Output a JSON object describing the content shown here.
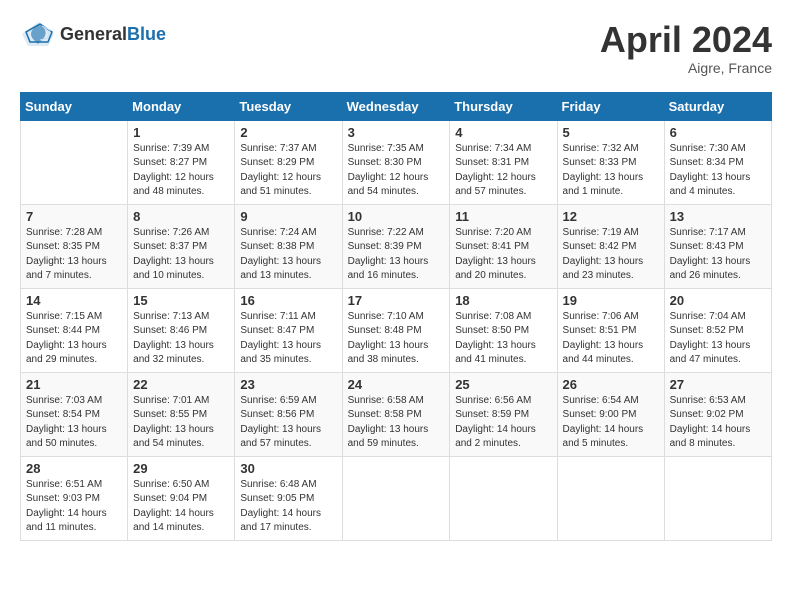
{
  "logo": {
    "general": "General",
    "blue": "Blue"
  },
  "title": "April 2024",
  "location": "Aigre, France",
  "calendar": {
    "headers": [
      "Sunday",
      "Monday",
      "Tuesday",
      "Wednesday",
      "Thursday",
      "Friday",
      "Saturday"
    ],
    "weeks": [
      [
        {
          "day": "",
          "info": ""
        },
        {
          "day": "1",
          "info": "Sunrise: 7:39 AM\nSunset: 8:27 PM\nDaylight: 12 hours\nand 48 minutes."
        },
        {
          "day": "2",
          "info": "Sunrise: 7:37 AM\nSunset: 8:29 PM\nDaylight: 12 hours\nand 51 minutes."
        },
        {
          "day": "3",
          "info": "Sunrise: 7:35 AM\nSunset: 8:30 PM\nDaylight: 12 hours\nand 54 minutes."
        },
        {
          "day": "4",
          "info": "Sunrise: 7:34 AM\nSunset: 8:31 PM\nDaylight: 12 hours\nand 57 minutes."
        },
        {
          "day": "5",
          "info": "Sunrise: 7:32 AM\nSunset: 8:33 PM\nDaylight: 13 hours\nand 1 minute."
        },
        {
          "day": "6",
          "info": "Sunrise: 7:30 AM\nSunset: 8:34 PM\nDaylight: 13 hours\nand 4 minutes."
        }
      ],
      [
        {
          "day": "7",
          "info": "Sunrise: 7:28 AM\nSunset: 8:35 PM\nDaylight: 13 hours\nand 7 minutes."
        },
        {
          "day": "8",
          "info": "Sunrise: 7:26 AM\nSunset: 8:37 PM\nDaylight: 13 hours\nand 10 minutes."
        },
        {
          "day": "9",
          "info": "Sunrise: 7:24 AM\nSunset: 8:38 PM\nDaylight: 13 hours\nand 13 minutes."
        },
        {
          "day": "10",
          "info": "Sunrise: 7:22 AM\nSunset: 8:39 PM\nDaylight: 13 hours\nand 16 minutes."
        },
        {
          "day": "11",
          "info": "Sunrise: 7:20 AM\nSunset: 8:41 PM\nDaylight: 13 hours\nand 20 minutes."
        },
        {
          "day": "12",
          "info": "Sunrise: 7:19 AM\nSunset: 8:42 PM\nDaylight: 13 hours\nand 23 minutes."
        },
        {
          "day": "13",
          "info": "Sunrise: 7:17 AM\nSunset: 8:43 PM\nDaylight: 13 hours\nand 26 minutes."
        }
      ],
      [
        {
          "day": "14",
          "info": "Sunrise: 7:15 AM\nSunset: 8:44 PM\nDaylight: 13 hours\nand 29 minutes."
        },
        {
          "day": "15",
          "info": "Sunrise: 7:13 AM\nSunset: 8:46 PM\nDaylight: 13 hours\nand 32 minutes."
        },
        {
          "day": "16",
          "info": "Sunrise: 7:11 AM\nSunset: 8:47 PM\nDaylight: 13 hours\nand 35 minutes."
        },
        {
          "day": "17",
          "info": "Sunrise: 7:10 AM\nSunset: 8:48 PM\nDaylight: 13 hours\nand 38 minutes."
        },
        {
          "day": "18",
          "info": "Sunrise: 7:08 AM\nSunset: 8:50 PM\nDaylight: 13 hours\nand 41 minutes."
        },
        {
          "day": "19",
          "info": "Sunrise: 7:06 AM\nSunset: 8:51 PM\nDaylight: 13 hours\nand 44 minutes."
        },
        {
          "day": "20",
          "info": "Sunrise: 7:04 AM\nSunset: 8:52 PM\nDaylight: 13 hours\nand 47 minutes."
        }
      ],
      [
        {
          "day": "21",
          "info": "Sunrise: 7:03 AM\nSunset: 8:54 PM\nDaylight: 13 hours\nand 50 minutes."
        },
        {
          "day": "22",
          "info": "Sunrise: 7:01 AM\nSunset: 8:55 PM\nDaylight: 13 hours\nand 54 minutes."
        },
        {
          "day": "23",
          "info": "Sunrise: 6:59 AM\nSunset: 8:56 PM\nDaylight: 13 hours\nand 57 minutes."
        },
        {
          "day": "24",
          "info": "Sunrise: 6:58 AM\nSunset: 8:58 PM\nDaylight: 13 hours\nand 59 minutes."
        },
        {
          "day": "25",
          "info": "Sunrise: 6:56 AM\nSunset: 8:59 PM\nDaylight: 14 hours\nand 2 minutes."
        },
        {
          "day": "26",
          "info": "Sunrise: 6:54 AM\nSunset: 9:00 PM\nDaylight: 14 hours\nand 5 minutes."
        },
        {
          "day": "27",
          "info": "Sunrise: 6:53 AM\nSunset: 9:02 PM\nDaylight: 14 hours\nand 8 minutes."
        }
      ],
      [
        {
          "day": "28",
          "info": "Sunrise: 6:51 AM\nSunset: 9:03 PM\nDaylight: 14 hours\nand 11 minutes."
        },
        {
          "day": "29",
          "info": "Sunrise: 6:50 AM\nSunset: 9:04 PM\nDaylight: 14 hours\nand 14 minutes."
        },
        {
          "day": "30",
          "info": "Sunrise: 6:48 AM\nSunset: 9:05 PM\nDaylight: 14 hours\nand 17 minutes."
        },
        {
          "day": "",
          "info": ""
        },
        {
          "day": "",
          "info": ""
        },
        {
          "day": "",
          "info": ""
        },
        {
          "day": "",
          "info": ""
        }
      ]
    ]
  }
}
